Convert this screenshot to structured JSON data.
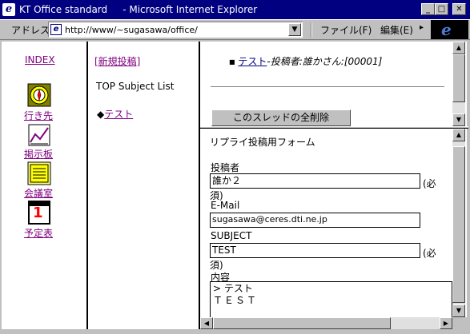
{
  "window": {
    "title": "KT Office standard     - Microsoft Internet Explorer",
    "minimize": "_",
    "maximize": "□",
    "close": "✕"
  },
  "toolbar": {
    "address_label": "アドレス",
    "url": "http://www/~sugasawa/office/",
    "menu_file": "ファイル(F)",
    "menu_edit": "編集(E)"
  },
  "nav": {
    "index": "INDEX",
    "items": [
      {
        "label": "行き先",
        "icon": "compass-icon"
      },
      {
        "label": "掲示板",
        "icon": "bulletin-board-icon"
      },
      {
        "label": "会議室",
        "icon": "meeting-room-icon"
      },
      {
        "label": "予定表",
        "icon": "calendar-icon",
        "icon_text": "1"
      }
    ]
  },
  "list": {
    "new_post": "[新規投稿]",
    "subject_header": "TOP Subject List",
    "bullet": "◆",
    "thread": "テスト"
  },
  "thread_view": {
    "post_link": "テスト",
    "post_meta": "-投稿者:誰かさん:[00001]",
    "delete_button": "このスレッドの全削除"
  },
  "reply_form": {
    "heading": "リプライ投稿用フォーム",
    "author_label": "投稿者",
    "author_value": "誰か２",
    "required_a": "(必",
    "required_b": "須)",
    "email_label": "E-Mail",
    "email_value": "sugasawa@ceres.dti.ne.jp",
    "subject_label": "SUBJECT",
    "subject_value": "TEST",
    "body_label": "内容",
    "body_line1": "> テスト",
    "body_line2": "ＴＥＳＴ"
  }
}
